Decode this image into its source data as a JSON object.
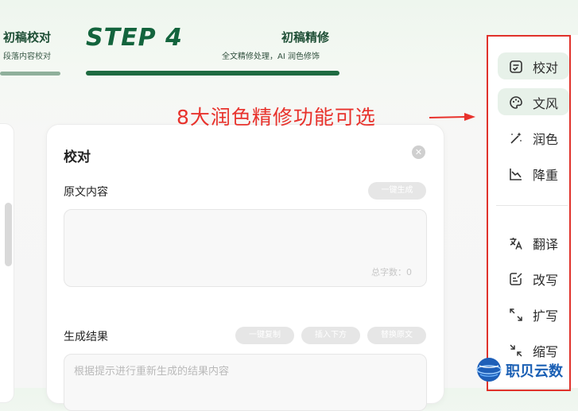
{
  "steps": {
    "previous": {
      "title": "初稿校对",
      "subtitle": "段落内容校对"
    },
    "current": {
      "number": "STEP 4",
      "title": "初稿精修",
      "subtitle": "全文精修处理，AI 润色修饰"
    }
  },
  "annotation": {
    "text": "8大润色精修功能可选",
    "color": "#e8322c"
  },
  "card": {
    "title": "校对",
    "original": {
      "label": "原文内容",
      "generate_button": "一键生成",
      "char_count": "总字数：0"
    },
    "result": {
      "label": "生成结果",
      "copy_button": "一键复制",
      "insert_button": "插入下方",
      "replace_button": "替换原文",
      "placeholder": "根据提示进行重新生成的结果内容"
    }
  },
  "sidebar": {
    "items": [
      {
        "label": "校对",
        "icon": "proofread-icon",
        "active": true
      },
      {
        "label": "文风",
        "icon": "palette-icon",
        "active": true
      },
      {
        "label": "润色",
        "icon": "magic-wand-icon",
        "active": false
      },
      {
        "label": "降重",
        "icon": "trend-down-icon",
        "active": false
      },
      {
        "label": "翻译",
        "icon": "translate-icon",
        "active": false
      },
      {
        "label": "改写",
        "icon": "edit-document-icon",
        "active": false
      },
      {
        "label": "扩写",
        "icon": "expand-icon",
        "active": false
      },
      {
        "label": "缩写",
        "icon": "shrink-icon",
        "active": false
      }
    ]
  },
  "watermark": {
    "text": "职贝云数"
  },
  "colors": {
    "brand_green": "#1e6b41",
    "annotation_red": "#e0322b",
    "active_bg": "#e7f1e9"
  }
}
